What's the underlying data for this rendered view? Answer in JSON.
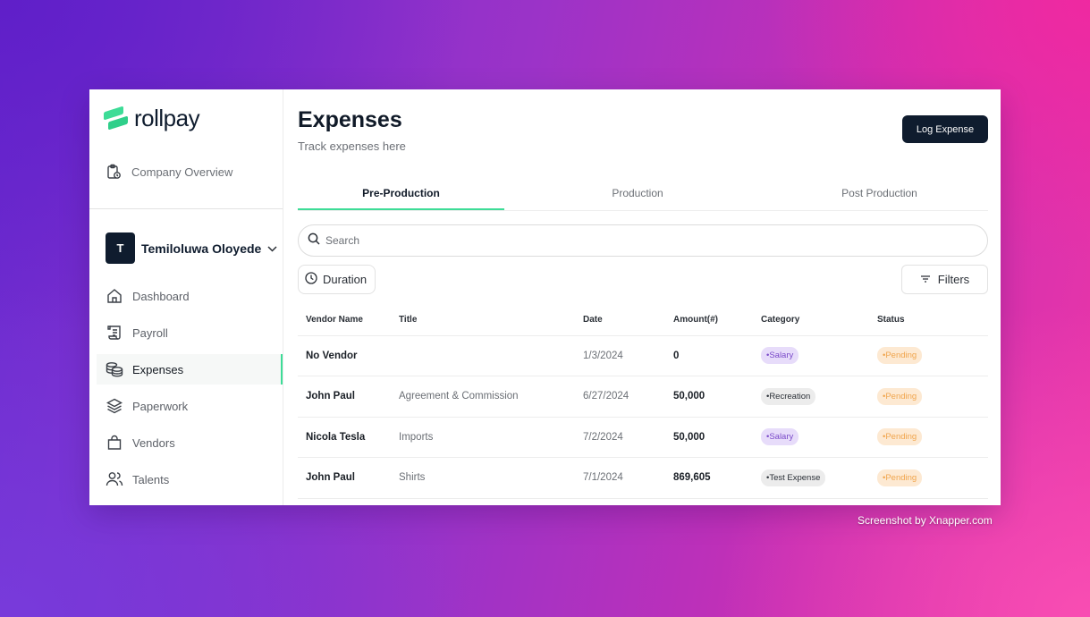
{
  "brand": {
    "name": "rollpay",
    "color": "#3ddc97"
  },
  "sidebar": {
    "company_overview": "Company Overview",
    "user": {
      "initial": "T",
      "name": "Temiloluwa Oloyede"
    },
    "items": [
      {
        "label": "Dashboard",
        "icon": "home-icon"
      },
      {
        "label": "Payroll",
        "icon": "scroll-icon"
      },
      {
        "label": "Expenses",
        "icon": "coins-icon",
        "active": true
      },
      {
        "label": "Paperwork",
        "icon": "layers-icon"
      },
      {
        "label": "Vendors",
        "icon": "shopping-bag-icon"
      },
      {
        "label": "Talents",
        "icon": "users-icon"
      }
    ]
  },
  "header": {
    "title": "Expenses",
    "subtitle": "Track expenses here",
    "log_button": "Log Expense"
  },
  "tabs": [
    "Pre-Production",
    "Production",
    "Post Production"
  ],
  "search": {
    "placeholder": "Search"
  },
  "duration_label": "Duration",
  "filters_label": "Filters",
  "table": {
    "columns": [
      "Vendor Name",
      "Title",
      "Date",
      "Amount(#)",
      "Category",
      "Status"
    ],
    "rows": [
      {
        "vendor": "No Vendor",
        "title": "",
        "date": "1/3/2024",
        "amount": "0",
        "category": "•Salary",
        "status": "•Pending"
      },
      {
        "vendor": "John Paul",
        "title": "Agreement & Commission",
        "date": "6/27/2024",
        "amount": "50,000",
        "category": "•Recreation",
        "status": "•Pending"
      },
      {
        "vendor": "Nicola Tesla",
        "title": "Imports",
        "date": "7/2/2024",
        "amount": "50,000",
        "category": "•Salary",
        "status": "•Pending"
      },
      {
        "vendor": "John Paul",
        "title": "Shirts",
        "date": "7/1/2024",
        "amount": "869,605",
        "category": "•Test Expense",
        "status": "•Pending"
      }
    ]
  },
  "watermark": "Screenshot by Xnapper.com"
}
